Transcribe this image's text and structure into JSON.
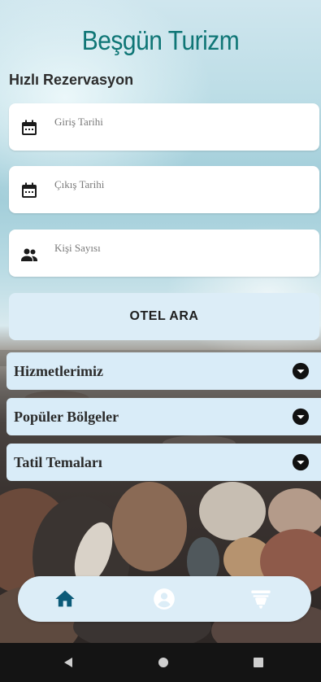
{
  "app": {
    "title": "Beşgün Turizm",
    "subtitle": "Hızlı Rezervasyon"
  },
  "reservation": {
    "checkin_label": "Giriş Tarihi",
    "checkout_label": "Çıkış Tarihi",
    "guests_label": "Kişi Sayısı",
    "search_button": "OTEL ARA"
  },
  "sections": [
    {
      "label": "Hizmetlerimiz",
      "icon": "chevron-down-circle-icon"
    },
    {
      "label": "Popüler Bölgeler",
      "icon": "chevron-down-circle-icon"
    },
    {
      "label": "Tatil Temaları",
      "icon": "chevron-down-circle-icon"
    }
  ],
  "bottom_nav": {
    "items": [
      {
        "icon": "home-icon",
        "active": true
      },
      {
        "icon": "account-icon",
        "active": false
      },
      {
        "icon": "bell-concierge-icon",
        "active": false
      }
    ]
  },
  "colors": {
    "brand": "#0f7676",
    "active_nav": "#0b5a78",
    "inactive_nav": "#ffffff",
    "panel": "#dcedf7"
  }
}
